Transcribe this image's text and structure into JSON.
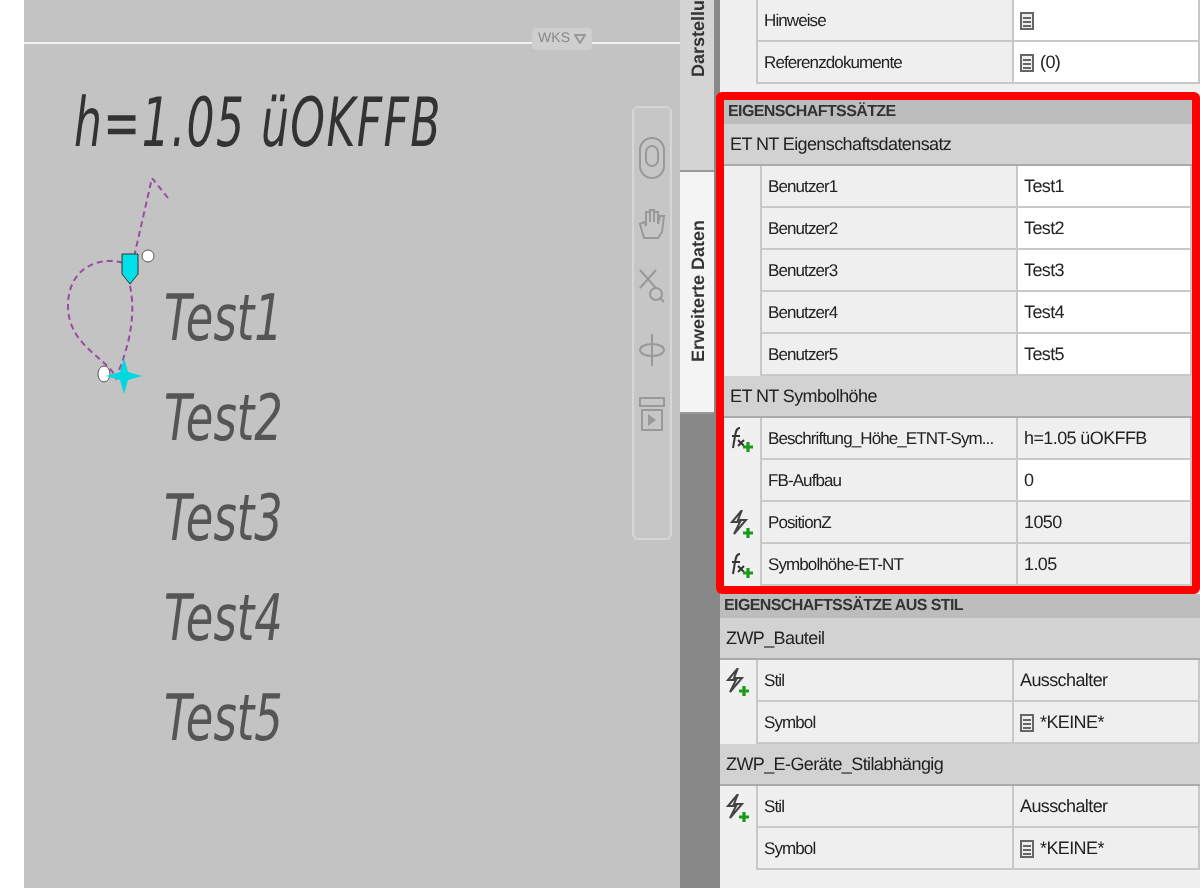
{
  "canvas": {
    "viewport_label": "WKS",
    "annotation": "h=1.05 üOKFFB",
    "lines": [
      "Test1",
      "Test2",
      "Test3",
      "Test4",
      "Test5"
    ]
  },
  "side_tabs": [
    {
      "label": "Darstellu",
      "selected": false
    },
    {
      "label": "Erweiterte Daten",
      "selected": true
    }
  ],
  "properties": {
    "top_rows": [
      {
        "name": "Hinweise",
        "value_icon": true
      },
      {
        "name": "Referenzdokumente",
        "value_icon": true,
        "value": "(0)"
      }
    ],
    "sections": [
      {
        "title": "EIGENSCHAFTSSÄTZE",
        "highlighted": true,
        "groups": [
          {
            "title": "ET NT Eigenschaftsdatensatz",
            "rows": [
              {
                "name": "Benutzer1",
                "value": "Test1",
                "editable": true
              },
              {
                "name": "Benutzer2",
                "value": "Test2",
                "editable": true
              },
              {
                "name": "Benutzer3",
                "value": "Test3",
                "editable": true
              },
              {
                "name": "Benutzer4",
                "value": "Test4",
                "editable": true
              },
              {
                "name": "Benutzer5",
                "value": "Test5",
                "editable": true
              }
            ]
          },
          {
            "title": "ET NT Symbolhöhe",
            "rows": [
              {
                "name": "Beschriftung_Höhe_ETNT-Sym...",
                "value": "h=1.05 üOKFFB",
                "kind": "formula",
                "editable": false
              },
              {
                "name": "FB-Aufbau",
                "value": "0",
                "editable": true
              },
              {
                "name": "PositionZ",
                "value": "1050",
                "kind": "lightning",
                "editable": false
              },
              {
                "name": "Symbolhöhe-ET-NT",
                "value": "1.05",
                "kind": "formula",
                "editable": false
              }
            ]
          }
        ]
      },
      {
        "title": "EIGENSCHAFTSSÄTZE AUS STIL",
        "highlighted": false,
        "groups": [
          {
            "title": "ZWP_Bauteil",
            "rows": [
              {
                "name": "Stil",
                "value": "Ausschalter",
                "kind": "lightning",
                "editable": false
              },
              {
                "name": "Symbol",
                "value": "*KEINE*",
                "value_icon": true,
                "editable": false
              }
            ]
          },
          {
            "title": "ZWP_E-Geräte_Stilabhängig",
            "rows": [
              {
                "name": "Stil",
                "value": "Ausschalter",
                "kind": "lightning",
                "editable": false
              },
              {
                "name": "Symbol",
                "value": "*KEINE*",
                "value_icon": true,
                "editable": false
              }
            ]
          }
        ]
      }
    ]
  }
}
